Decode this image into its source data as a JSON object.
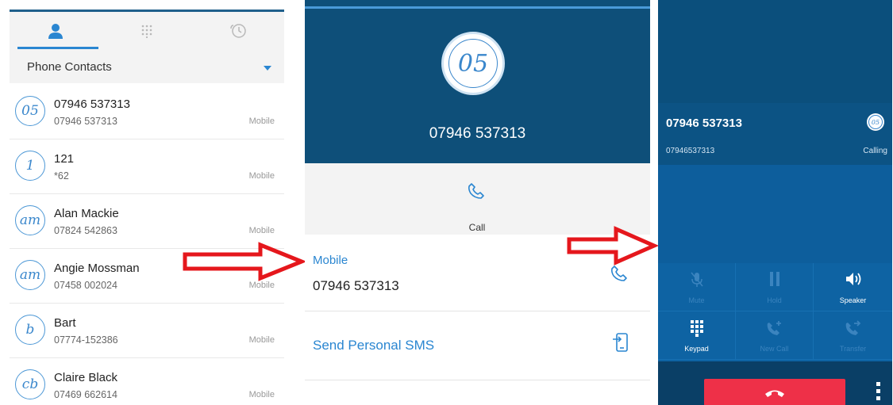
{
  "contacts_panel": {
    "tabs": [
      {
        "icon": "person-icon",
        "active": true
      },
      {
        "icon": "dialpad-icon",
        "active": false
      },
      {
        "icon": "history-icon",
        "active": false
      }
    ],
    "source_label": "Phone Contacts",
    "contacts": [
      {
        "initials": "05",
        "name": "07946 537313",
        "number": "07946 537313",
        "type": "Mobile"
      },
      {
        "initials": "1",
        "name": "121",
        "number": "*62",
        "type": "Mobile"
      },
      {
        "initials": "am",
        "name": "Alan Mackie",
        "number": "07824 542863",
        "type": "Mobile"
      },
      {
        "initials": "am",
        "name": "Angie Mossman",
        "number": "07458 002024",
        "type": "Mobile"
      },
      {
        "initials": "b",
        "name": "Bart",
        "number": "07774-152386",
        "type": "Mobile"
      },
      {
        "initials": "cb",
        "name": "Claire Black",
        "number": "07469 662614",
        "type": "Mobile"
      }
    ]
  },
  "detail_panel": {
    "avatar_initials": "05",
    "title": "07946 537313",
    "call_label": "Call",
    "mobile_label": "Mobile",
    "mobile_number": "07946 537313",
    "sms_label": "Send Personal SMS"
  },
  "call_panel": {
    "name": "07946 537313",
    "number": "07946537313",
    "status": "Calling",
    "avatar_initials": "05",
    "controls": [
      {
        "label": "Mute",
        "icon": "mic-off-icon",
        "enabled": false
      },
      {
        "label": "Hold",
        "icon": "pause-icon",
        "enabled": false
      },
      {
        "label": "Speaker",
        "icon": "speaker-icon",
        "enabled": true
      },
      {
        "label": "Keypad",
        "icon": "keypad-icon",
        "enabled": true
      },
      {
        "label": "New Call",
        "icon": "add-call-icon",
        "enabled": false
      },
      {
        "label": "Transfer",
        "icon": "transfer-icon",
        "enabled": false
      }
    ]
  },
  "colors": {
    "accent": "#2a86d1",
    "header_blue": "#0e4f79",
    "end_call_red": "#ee3048",
    "arrow_red": "#e5171c"
  }
}
